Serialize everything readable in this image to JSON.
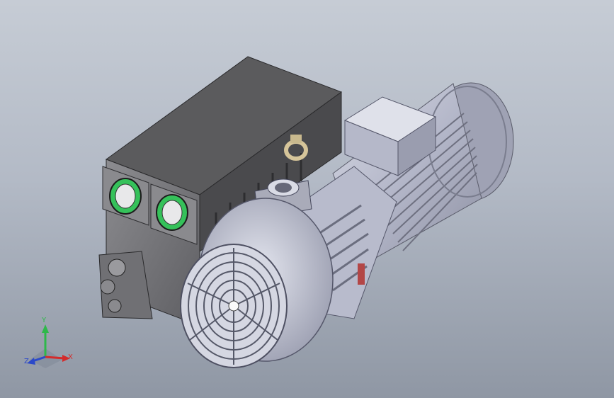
{
  "viewport": {
    "background_top": "#c6ccd5",
    "background_bottom": "#8f97a4"
  },
  "model": {
    "body_color": "#7f7f83",
    "cover_color": "#5b5b5d",
    "motor_color": "#b9bccc",
    "seal_color": "#35c15a"
  },
  "triad": {
    "x_label": "X",
    "y_label": "Y",
    "z_label": "Z",
    "x_color": "#d42b2b",
    "y_color": "#2eb84a",
    "z_color": "#2b49c9"
  }
}
